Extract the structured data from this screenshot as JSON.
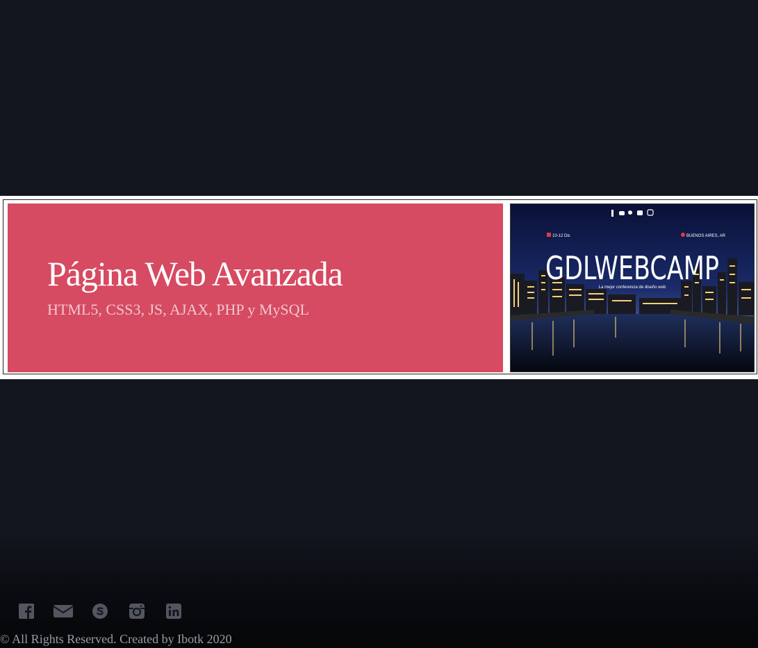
{
  "hero": {
    "title": "Página Web Avanzada",
    "subtitle": "HTML5, CSS3, JS, AJAX, PHP y MySQL"
  },
  "banner": {
    "brand": "GDLWEBCAMP",
    "tagline": "La mejor conferencia de diseño web",
    "date": "10-12 Dic",
    "location": "BUENOS AIRES, AR"
  },
  "footer": {
    "icons": [
      "facebook-icon",
      "envelope-icon",
      "skype-icon",
      "instagram-icon",
      "linkedin-icon"
    ],
    "copyright": "© All Rights Reserved. Created by Ibotk 2020"
  },
  "colors": {
    "background": "#13161f",
    "accent": "#d64a62",
    "footer_icon": "#53565e"
  }
}
